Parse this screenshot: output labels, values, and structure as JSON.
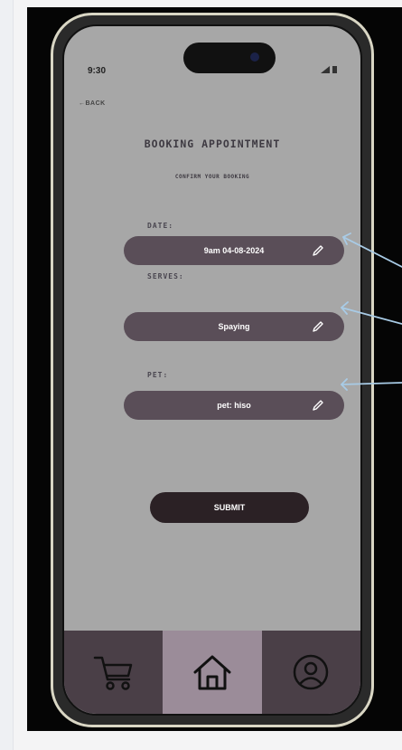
{
  "status": {
    "time": "9:30"
  },
  "nav": {
    "back_label": "←BACK"
  },
  "page": {
    "title": "BOOKING APPOINTMENT",
    "subtitle": "CONFIRM YOUR BOOKING"
  },
  "fields": {
    "date": {
      "label": "DATE:",
      "value": "9am 04-08-2024"
    },
    "serves": {
      "label": "SERVES:",
      "value": "Spaying"
    },
    "pet": {
      "label": "PET:",
      "value": "pet: hiso"
    }
  },
  "actions": {
    "submit_label": "SUBMIT"
  },
  "tabbar": {
    "items": [
      {
        "icon": "cart-icon",
        "active": false
      },
      {
        "icon": "home-icon",
        "active": true
      },
      {
        "icon": "profile-icon",
        "active": false
      }
    ]
  },
  "colors": {
    "screen_bg": "#a7a7a7",
    "pill_bg": "#5a4e58",
    "submit_bg": "#2b2125",
    "tabbar_bg": "#4a3f47",
    "tab_active_bg": "#9b8c99",
    "annotation_arrow": "#a8cbe6"
  }
}
